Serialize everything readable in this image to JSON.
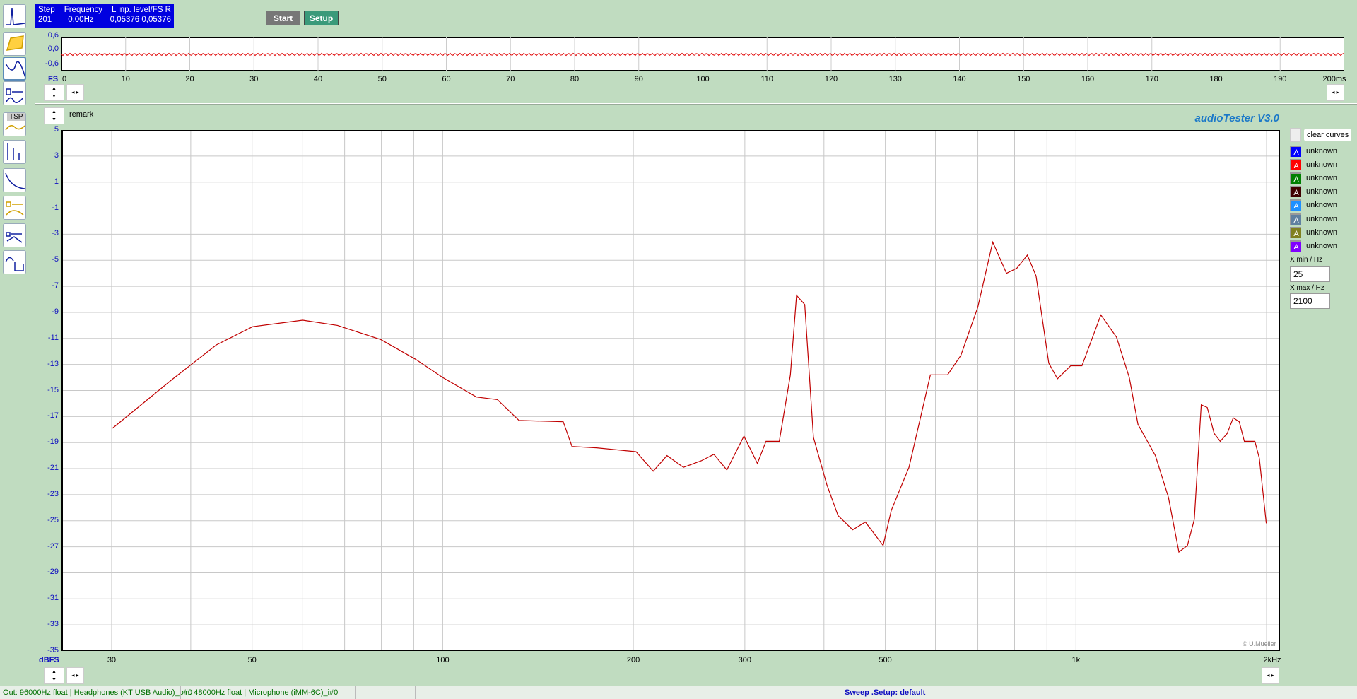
{
  "toolbar": {
    "icons": [
      "spectrum-icon",
      "waterfall-icon",
      "frequency-response-icon",
      "speaker-impedance-icon",
      "tsp-icon",
      "distortion-icon",
      "filter-icon",
      "speaker-thiele-icon",
      "speaker-waterfall-icon",
      "oscilloscope-icon"
    ],
    "tsp_label": "TSP"
  },
  "info": {
    "step_label": "Step",
    "step_value": "201",
    "freq_label": "Frequency",
    "freq_value": "0,00Hz",
    "level_label": "L  inp. level/FS  R",
    "level_l": "0,05376",
    "level_r": "0,05376"
  },
  "buttons": {
    "start": "Start",
    "setup": "Setup"
  },
  "scope": {
    "y_labels": [
      "0,6",
      "0,0",
      "-0,6"
    ],
    "unit": "FS",
    "x_labels": [
      "0",
      "10",
      "20",
      "30",
      "40",
      "50",
      "60",
      "70",
      "80",
      "90",
      "100",
      "110",
      "120",
      "130",
      "140",
      "150",
      "160",
      "170",
      "180",
      "190",
      "200ms"
    ]
  },
  "main": {
    "remark": "remark",
    "app_title": "audioTester  V3.0",
    "copyright": "© U.Mueller"
  },
  "legend": {
    "clear": "clear curves",
    "items": [
      {
        "label": "unknown",
        "color": "#0000ff"
      },
      {
        "label": "unknown",
        "color": "#ff0000"
      },
      {
        "label": "unknown",
        "color": "#008000"
      },
      {
        "label": "unknown",
        "color": "#400000"
      },
      {
        "label": "unknown",
        "color": "#1e90ff"
      },
      {
        "label": "unknown",
        "color": "#6080a0"
      },
      {
        "label": "unknown",
        "color": "#808020"
      },
      {
        "label": "unknown",
        "color": "#8000ff"
      }
    ],
    "swatch_letter": "A",
    "xmin_label": "X min / Hz",
    "xmin": "25",
    "xmax_label": "X max / Hz",
    "xmax": "2100"
  },
  "status": {
    "out": "Out: 96000Hz float  | Headphones (KT USB Audio)_o#0",
    "in": "In: 48000Hz float  | Microphone (iMM-6C)_i#0",
    "sweep": "Sweep .Setup:  default"
  },
  "chart_data": {
    "type": "line",
    "xscale": "log",
    "xlim": [
      25,
      2100
    ],
    "ylim": [
      -35,
      5
    ],
    "ylabel": "dBFS",
    "xlabel": "Hz",
    "y_ticks": [
      "5",
      "3",
      "1",
      "-1",
      "-3",
      "-5",
      "-7",
      "-9",
      "-11",
      "-13",
      "-15",
      "-17",
      "-19",
      "-21",
      "-23",
      "-25",
      "-27",
      "-29",
      "-31",
      "-33",
      "-35"
    ],
    "x_ticks": [
      {
        "v": 30,
        "label": "30"
      },
      {
        "v": 50,
        "label": "50"
      },
      {
        "v": 100,
        "label": "100"
      },
      {
        "v": 200,
        "label": "200"
      },
      {
        "v": 300,
        "label": "300"
      },
      {
        "v": 500,
        "label": "500"
      },
      {
        "v": 1000,
        "label": "1k"
      },
      {
        "v": 2000,
        "label": "2kHz"
      }
    ],
    "x_grid": [
      30,
      40,
      50,
      60,
      70,
      80,
      90,
      100,
      200,
      300,
      400,
      500,
      600,
      700,
      800,
      900,
      1000,
      2000
    ],
    "series": [
      {
        "name": "unknown",
        "color": "#c00000",
        "x": [
          30.1,
          37.5,
          43.9,
          50.1,
          60.1,
          68.2,
          79.9,
          90.6,
          100,
          113,
          122,
          132,
          155,
          160,
          175,
          202,
          215,
          226,
          240,
          256,
          268,
          281,
          299,
          314,
          324,
          340,
          354,
          362,
          373,
          385,
          404,
          421,
          444,
          465,
          496,
          511,
          545,
          589,
          627,
          658,
          700,
          739,
          777,
          807,
          838,
          865,
          906,
          935,
          981,
          1022,
          1095,
          1159,
          1214,
          1253,
          1335,
          1400,
          1454,
          1500,
          1538,
          1577,
          1612,
          1653,
          1690,
          1733,
          1772,
          1811,
          1845,
          1917,
          1948,
          1998
        ],
        "y": [
          -17.9,
          -14.1,
          -11.5,
          -10.1,
          -9.6,
          -10.0,
          -11.1,
          -12.6,
          -14.0,
          -15.5,
          -15.7,
          -17.3,
          -17.4,
          -19.3,
          -19.4,
          -19.7,
          -21.2,
          -20.0,
          -20.9,
          -20.4,
          -19.9,
          -21.1,
          -18.5,
          -20.6,
          -18.9,
          -18.9,
          -13.8,
          -7.7,
          -8.4,
          -18.6,
          -22.2,
          -24.6,
          -25.7,
          -25.1,
          -26.9,
          -24.2,
          -20.9,
          -13.8,
          -13.8,
          -12.3,
          -8.6,
          -3.6,
          -6.0,
          -5.6,
          -4.6,
          -6.2,
          -12.9,
          -14.1,
          -13.1,
          -13.1,
          -9.2,
          -10.9,
          -14.0,
          -17.6,
          -20.0,
          -23.2,
          -27.4,
          -26.9,
          -24.9,
          -16.1,
          -16.3,
          -18.3,
          -18.9,
          -18.3,
          -17.1,
          -17.4,
          -18.9,
          -18.9,
          -20.2,
          -25.2
        ]
      }
    ]
  }
}
